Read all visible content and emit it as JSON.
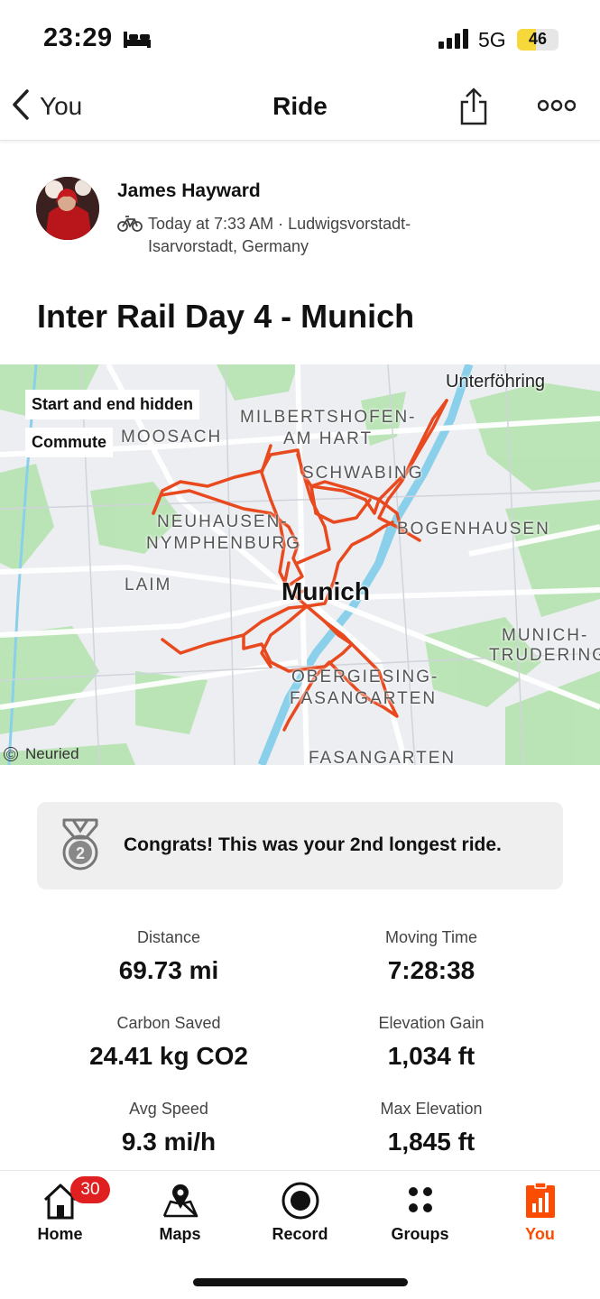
{
  "status_bar": {
    "time": "23:29",
    "network": "5G",
    "battery": "46",
    "battery_level": 0.46,
    "battery_color": "#f7d83b",
    "icons": [
      "bed-icon",
      "signal-icon",
      "battery-icon"
    ]
  },
  "nav": {
    "back_label": "You",
    "title": "Ride",
    "icons": [
      "chevron-left-icon",
      "share-icon",
      "more-icon"
    ]
  },
  "athlete": {
    "name": "James Hayward",
    "meta": "Today at 7:33 AM · Ludwigsvorstadt-Isarvorstadt, Germany",
    "icon": "bike-icon"
  },
  "activity": {
    "title": "Inter Rail Day 4 - Munich"
  },
  "map": {
    "chips": [
      "Start and end hidden",
      "Commute"
    ],
    "places": {
      "unterfohring": "Unterföhring",
      "milbertshofen": "MILBERTSHOFEN-",
      "am_hart": "AM HART",
      "moosach": "MOOSACH",
      "schwabing": "SCHWABING",
      "neuhausen": "NEUHAUSEN-",
      "nymphenburg": "NYMPHENBURG",
      "bogenhausen": "BOGENHAUSEN",
      "laim": "LAIM",
      "munich": "Munich",
      "munich_trudering_1": "MUNICH-",
      "munich_trudering_2": "TRUDERING",
      "obergiesing": "OBERGIESING-",
      "fasangarten_1": "FASANGARTEN",
      "fasangarten_2": "FASANGARTEN"
    },
    "attribution": "Neuried",
    "route_color": "#e8491e"
  },
  "achievement": {
    "message": "Congrats! This was your 2nd longest ride.",
    "icon": "medal-icon",
    "rank": "2"
  },
  "stats": [
    {
      "label": "Distance",
      "value": "69.73 mi"
    },
    {
      "label": "Moving Time",
      "value": "7:28:38"
    },
    {
      "label": "Carbon Saved",
      "value": "24.41 kg CO2"
    },
    {
      "label": "Elevation Gain",
      "value": "1,034 ft"
    },
    {
      "label": "Avg Speed",
      "value": "9.3 mi/h"
    },
    {
      "label": "Max Elevation",
      "value": "1,845 ft"
    }
  ],
  "tabs": [
    {
      "label": "Home",
      "badge": "30",
      "icon": "home-icon"
    },
    {
      "label": "Maps",
      "icon": "map-pin-icon"
    },
    {
      "label": "Record",
      "icon": "record-icon"
    },
    {
      "label": "Groups",
      "icon": "groups-icon"
    },
    {
      "label": "You",
      "icon": "you-icon",
      "active": true
    }
  ],
  "accent_color": "#fc4c02"
}
